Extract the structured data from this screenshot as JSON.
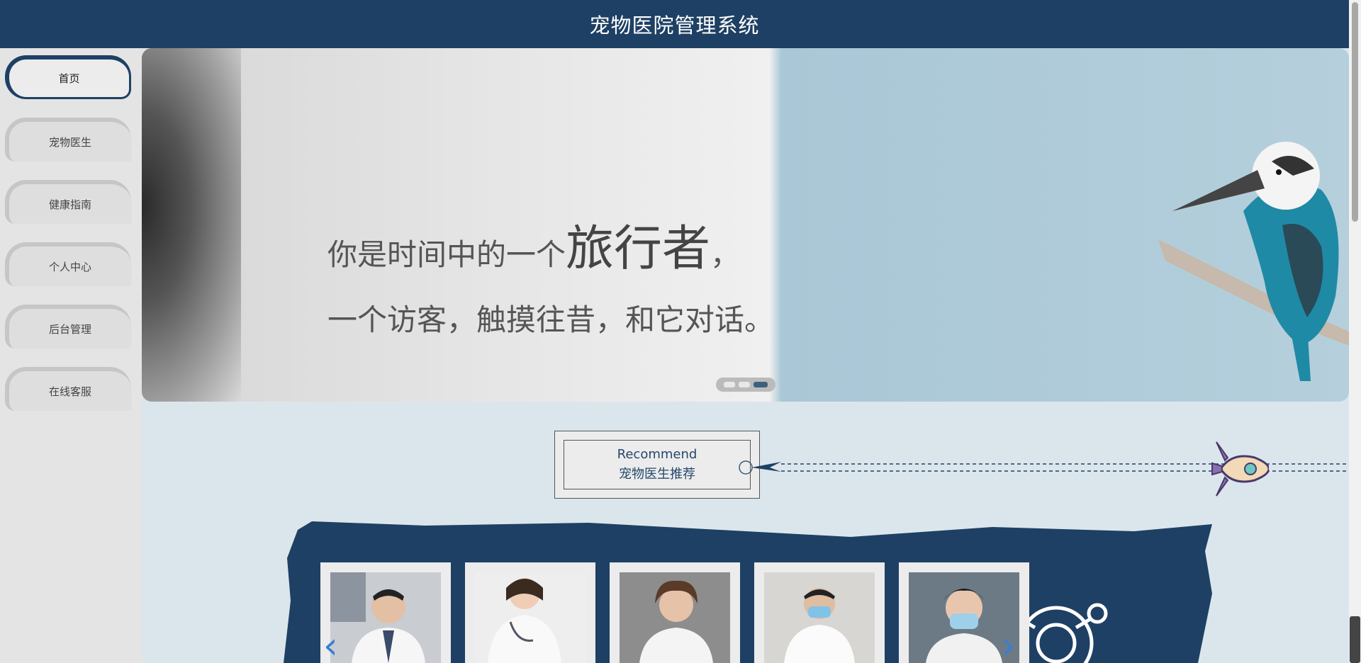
{
  "header": {
    "title": "宠物医院管理系统"
  },
  "sidebar": {
    "items": [
      {
        "label": "首页",
        "active": true
      },
      {
        "label": "宠物医生"
      },
      {
        "label": "健康指南"
      },
      {
        "label": "个人中心"
      },
      {
        "label": "后台管理"
      },
      {
        "label": "在线客服"
      }
    ]
  },
  "banner": {
    "line1_prefix": "你是时间中的一个",
    "line1_emphasis": "旅行者",
    "line1_suffix": "，",
    "line2": "一个访客，触摸往昔，和它对话。",
    "slide_count": 3,
    "active_slide": 3
  },
  "recommend": {
    "title_en": "Recommend",
    "title_cn": "宠物医生推荐"
  },
  "doctors": {
    "count_visible": 5,
    "prev_arrow": "‹",
    "next_arrow": "›"
  },
  "colors": {
    "primary": "#1e4064",
    "accent": "#3b7ed3",
    "background": "#dbe6ec"
  }
}
